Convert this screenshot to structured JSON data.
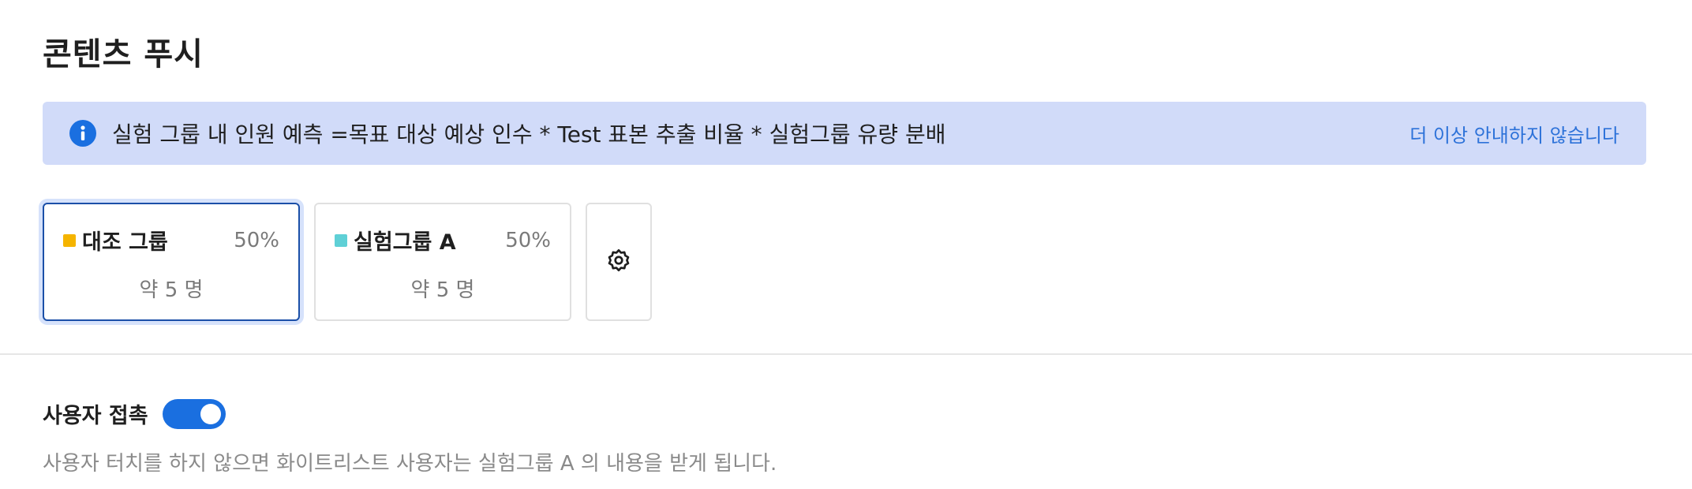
{
  "header": {
    "title": "콘텐츠 푸시"
  },
  "info_bar": {
    "text": "실험 그룹 내 인원 예측 =목표 대상 예상 인수 * Test 표본 추출 비율 * 실험그룹 유량 분배",
    "dismiss_label": "더 이상 안내하지 않습니다",
    "icon": "info-icon"
  },
  "groups": [
    {
      "name": "대조 그룹",
      "percent": "50%",
      "estimate": "약 5 명",
      "color": "#f5b400",
      "selected": true
    },
    {
      "name": "실험그룹 A",
      "percent": "50%",
      "estimate": "약 5 명",
      "color": "#5fd0d6",
      "selected": false
    }
  ],
  "settings": {
    "icon": "gear-icon"
  },
  "user_touch": {
    "label": "사용자 접촉",
    "enabled": true,
    "description": "사용자 터치를 하지 않으면 화이트리스트 사용자는 실험그룹 A 의 내용을 받게 됩니다."
  },
  "colors": {
    "accent": "#1a6fe0",
    "info_bg": "#d1dbf9",
    "link": "#2d72d9"
  }
}
